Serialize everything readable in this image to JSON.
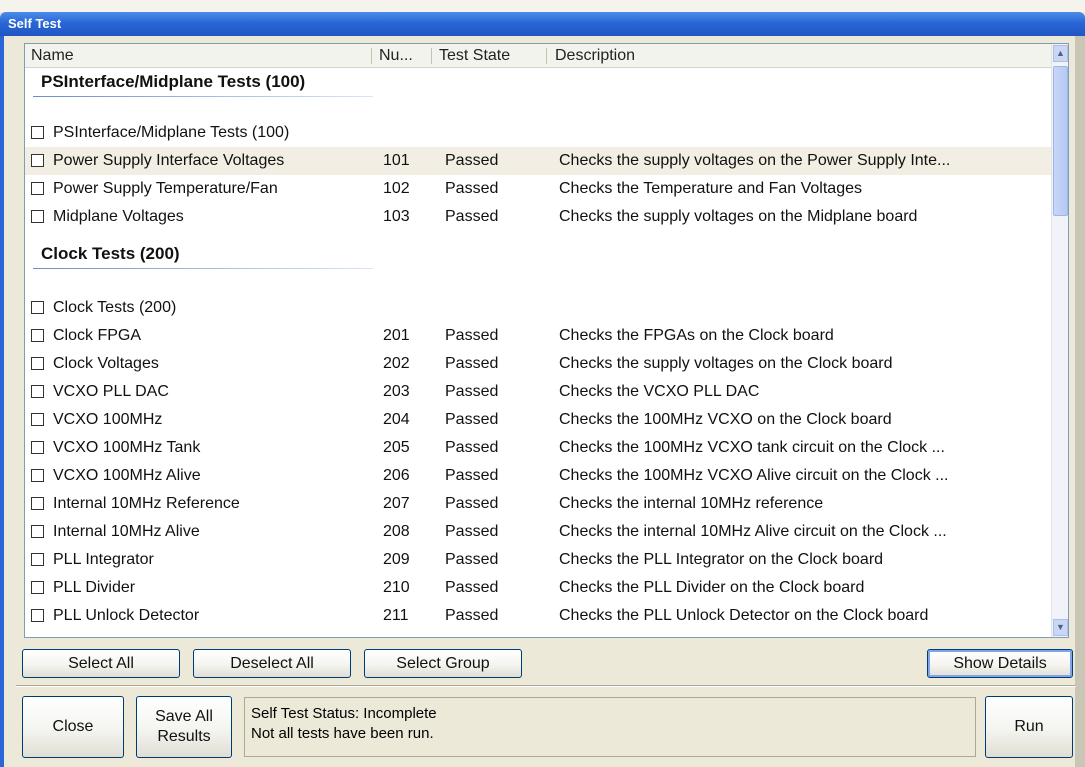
{
  "window": {
    "title": "Self Test"
  },
  "columns": {
    "name": "Name",
    "num": "Nu...",
    "state": "Test State",
    "desc": "Description"
  },
  "groups": [
    {
      "title": "PSInterface/Midplane Tests (100)",
      "items": [
        {
          "name": "PSInterface/Midplane Tests (100)",
          "num": "",
          "state": "",
          "desc": ""
        },
        {
          "name": "Power Supply Interface Voltages",
          "num": "101",
          "state": "Passed",
          "desc": "Checks the supply voltages on the Power Supply Inte..."
        },
        {
          "name": "Power Supply Temperature/Fan",
          "num": "102",
          "state": "Passed",
          "desc": "Checks the Temperature and Fan Voltages"
        },
        {
          "name": "Midplane Voltages",
          "num": "103",
          "state": "Passed",
          "desc": "Checks the supply voltages on the Midplane board"
        }
      ]
    },
    {
      "title": "Clock Tests (200)",
      "items": [
        {
          "name": "Clock Tests (200)",
          "num": "",
          "state": "",
          "desc": ""
        },
        {
          "name": "Clock FPGA",
          "num": "201",
          "state": "Passed",
          "desc": "Checks the FPGAs on the Clock board"
        },
        {
          "name": "Clock Voltages",
          "num": "202",
          "state": "Passed",
          "desc": "Checks the supply voltages on the Clock board"
        },
        {
          "name": "VCXO PLL DAC",
          "num": "203",
          "state": "Passed",
          "desc": "Checks the VCXO PLL DAC"
        },
        {
          "name": "VCXO 100MHz",
          "num": "204",
          "state": "Passed",
          "desc": "Checks the 100MHz VCXO on the Clock board"
        },
        {
          "name": "VCXO 100MHz Tank",
          "num": "205",
          "state": "Passed",
          "desc": "Checks the 100MHz VCXO tank circuit on the Clock ..."
        },
        {
          "name": "VCXO 100MHz Alive",
          "num": "206",
          "state": "Passed",
          "desc": "Checks the 100MHz VCXO Alive circuit on the Clock ..."
        },
        {
          "name": "Internal 10MHz Reference",
          "num": "207",
          "state": "Passed",
          "desc": "Checks the internal 10MHz reference"
        },
        {
          "name": "Internal 10MHz Alive",
          "num": "208",
          "state": "Passed",
          "desc": "Checks the internal 10MHz Alive circuit on the Clock ..."
        },
        {
          "name": "PLL Integrator",
          "num": "209",
          "state": "Passed",
          "desc": "Checks the PLL Integrator on the Clock board"
        },
        {
          "name": "PLL Divider",
          "num": "210",
          "state": "Passed",
          "desc": "Checks the PLL Divider on the Clock board"
        },
        {
          "name": "PLL Unlock Detector",
          "num": "211",
          "state": "Passed",
          "desc": "Checks the PLL Unlock Detector on the Clock board"
        }
      ]
    }
  ],
  "buttons": {
    "select_all": "Select All",
    "deselect_all": "Deselect All",
    "select_group": "Select Group",
    "show_details": "Show Details",
    "close": "Close",
    "save_all_line1": "Save All",
    "save_all_line2": "Results",
    "run": "Run"
  },
  "status": {
    "line1": "Self Test Status: Incomplete",
    "line2": "Not all tests have been run."
  },
  "colors": {
    "title_bar": "#2a66d6",
    "highlight_row": "#f2eee4",
    "window_bg": "#ece9d8"
  }
}
